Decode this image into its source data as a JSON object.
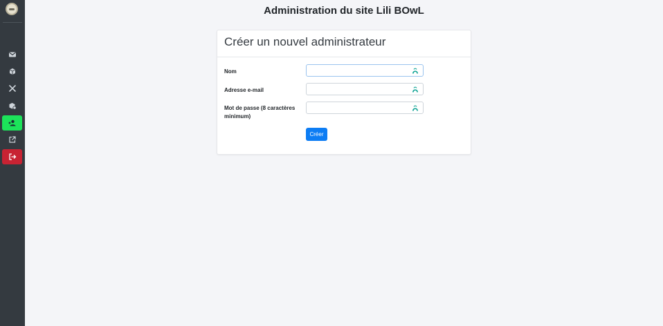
{
  "page": {
    "title": "Administration du site Lili BOwL"
  },
  "sidebar": {
    "items": [
      {
        "name": "messages",
        "icon": "envelope-icon",
        "active": false
      },
      {
        "name": "orders",
        "icon": "box-icon",
        "active": false
      },
      {
        "name": "menu",
        "icon": "utensils-icon",
        "active": false
      },
      {
        "name": "products",
        "icon": "settings-box-icon",
        "active": false
      },
      {
        "name": "add-admin",
        "icon": "user-plus-icon",
        "active": true
      },
      {
        "name": "external-site",
        "icon": "external-link-icon",
        "active": false
      },
      {
        "name": "logout",
        "icon": "logout-icon",
        "active": false
      }
    ],
    "active_color": "#1ce35a",
    "logout_color": "#c82333"
  },
  "form": {
    "heading": "Créer un nouvel administrateur",
    "fields": [
      {
        "label": "Nom",
        "value": "",
        "placeholder": ""
      },
      {
        "label": "Adresse e-mail",
        "value": "",
        "placeholder": ""
      },
      {
        "label": "Mot de passe (8 caractères minimum)",
        "value": "",
        "placeholder": ""
      }
    ],
    "submit_label": "Créer",
    "submit_color": "#0d7df4"
  }
}
